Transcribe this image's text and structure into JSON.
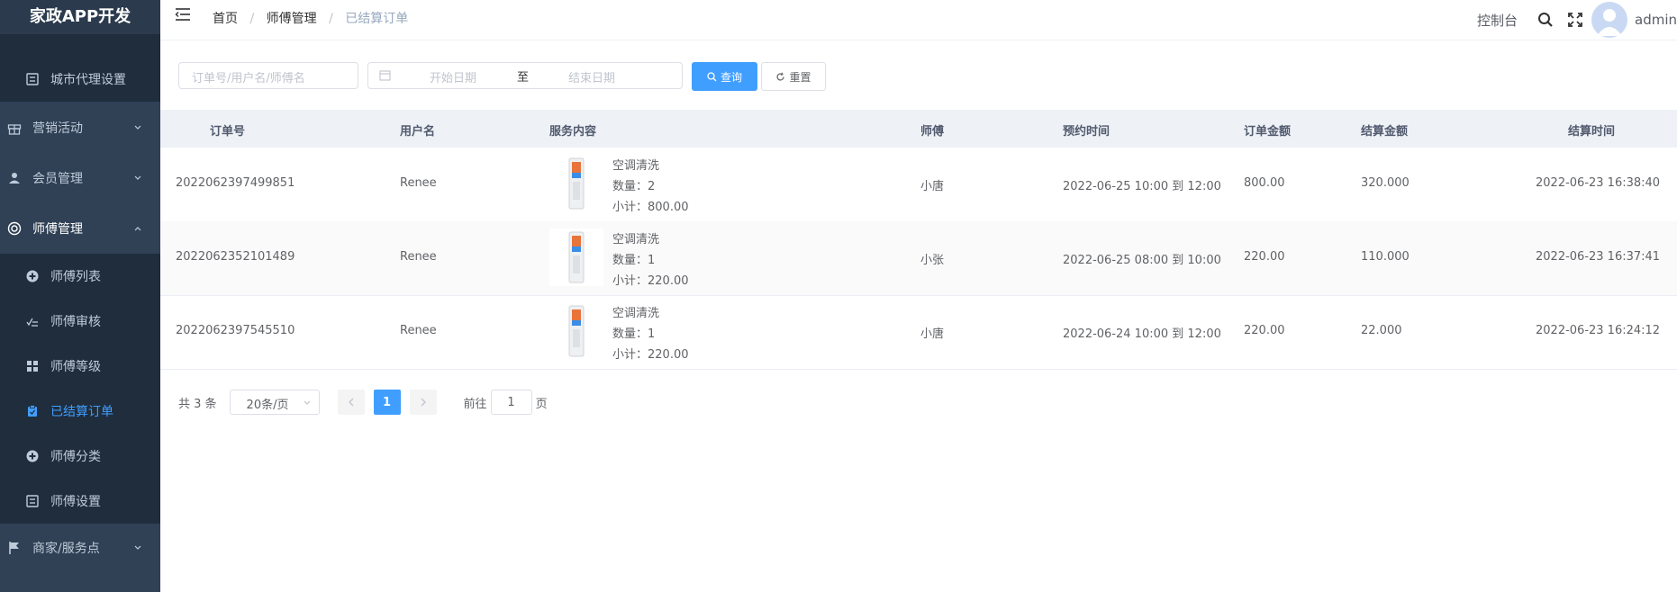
{
  "app": {
    "title": "家政APP开发"
  },
  "sidebar": {
    "items": [
      {
        "label": "城市代理设置",
        "icon": "settings-panel-icon",
        "level": "sub"
      },
      {
        "label": "营销活动",
        "icon": "gift-icon",
        "level": "top"
      },
      {
        "label": "会员管理",
        "icon": "user-icon",
        "level": "top"
      },
      {
        "label": "师傅管理",
        "icon": "lifebuoy-icon",
        "level": "top",
        "expanded": true
      },
      {
        "label": "师傅列表",
        "icon": "circle-plus-icon",
        "level": "sub"
      },
      {
        "label": "师傅审核",
        "icon": "checklist-icon",
        "level": "sub"
      },
      {
        "label": "师傅等级",
        "icon": "grid-icon",
        "level": "sub"
      },
      {
        "label": "已结算订单",
        "icon": "clipboard-check-icon",
        "level": "sub",
        "active": true
      },
      {
        "label": "师傅分类",
        "icon": "circle-plus-icon",
        "level": "sub"
      },
      {
        "label": "师傅设置",
        "icon": "settings-panel-icon",
        "level": "sub"
      },
      {
        "label": "商家/服务点",
        "icon": "flag-icon",
        "level": "top"
      }
    ]
  },
  "header": {
    "breadcrumbs": [
      "首页",
      "师傅管理",
      "已结算订单"
    ],
    "separator": "/",
    "console": "控制台",
    "user": "admin"
  },
  "filters": {
    "search_placeholder": "订单号/用户名/师傅名",
    "start_placeholder": "开始日期",
    "range_sep": "至",
    "end_placeholder": "结束日期",
    "search_btn": "查询",
    "reset_btn": "重置"
  },
  "table": {
    "columns": [
      "订单号",
      "用户名",
      "服务内容",
      "师傅",
      "预约时间",
      "订单金额",
      "结算金额",
      "结算时间"
    ],
    "rows": [
      {
        "order_no": "2022062397499851",
        "user": "Renee",
        "service": "空调清洗",
        "qty": "数量：2",
        "subtotal": "小计：800.00",
        "master": "小唐",
        "appt": "2022-06-25 10:00 到 12:00",
        "amount": "800.00",
        "settle": "320.000",
        "settle_time": "2022-06-23 16:38:40"
      },
      {
        "order_no": "2022062352101489",
        "user": "Renee",
        "service": "空调清洗",
        "qty": "数量：1",
        "subtotal": "小计：220.00",
        "master": "小张",
        "appt": "2022-06-25 08:00 到 10:00",
        "amount": "220.00",
        "settle": "110.000",
        "settle_time": "2022-06-23 16:37:41"
      },
      {
        "order_no": "2022062397545510",
        "user": "Renee",
        "service": "空调清洗",
        "qty": "数量：1",
        "subtotal": "小计：220.00",
        "master": "小唐",
        "appt": "2022-06-24 10:00 到 12:00",
        "amount": "220.00",
        "settle": "22.000",
        "settle_time": "2022-06-23 16:24:12"
      }
    ]
  },
  "pagination": {
    "total": "共 3 条",
    "page_size": "20条/页",
    "current": "1",
    "goto_label": "前往",
    "goto_value": "1",
    "page_unit": "页"
  },
  "colors": {
    "sidebar_bg": "#304156",
    "submenu_bg": "#1f2d3d",
    "accent": "#409eff"
  }
}
